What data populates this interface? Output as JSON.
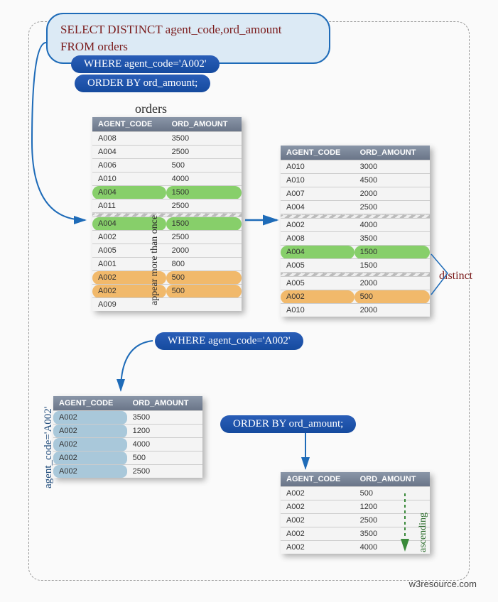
{
  "sql": {
    "line1": "SELECT  DISTINCT agent_code,ord_amount",
    "line2": "FROM orders",
    "where": "WHERE agent_code='A002'",
    "orderby": "ORDER BY ord_amount;"
  },
  "labels": {
    "orders": "orders",
    "appear": "appear more than once",
    "distinct": "distinct",
    "agentcode": "agent_code='A002'",
    "ascending": "ascending",
    "where2": "WHERE agent_code='A002'",
    "orderby2": "ORDER BY ord_amount;"
  },
  "headers": {
    "col1": "AGENT_CODE",
    "col2": "ORD_AMOUNT"
  },
  "tables": {
    "orders1": [
      [
        "A008",
        "3500"
      ],
      [
        "A004",
        "2500"
      ],
      [
        "A006",
        "500"
      ],
      [
        "A010",
        "4000"
      ],
      [
        "A004",
        "1500",
        "green"
      ],
      [
        "A011",
        "2500"
      ],
      [
        "tear"
      ],
      [
        "A004",
        "1500",
        "green"
      ],
      [
        "A002",
        "2500"
      ],
      [
        "A005",
        "2000"
      ],
      [
        "A001",
        "800"
      ],
      [
        "A002",
        "500",
        "orange"
      ],
      [
        "A002",
        "500",
        "orange"
      ],
      [
        "A009",
        ""
      ]
    ],
    "orders2": [
      [
        "A010",
        "3000"
      ],
      [
        "A010",
        "4500"
      ],
      [
        "A007",
        "2000"
      ],
      [
        "A004",
        "2500"
      ],
      [
        "tear"
      ],
      [
        "A002",
        "4000"
      ],
      [
        "A008",
        "3500"
      ],
      [
        "A004",
        "1500",
        "green"
      ],
      [
        "A005",
        "1500"
      ],
      [
        "tear"
      ],
      [
        "A005",
        "2000"
      ],
      [
        "A002",
        "500",
        "orange"
      ],
      [
        "A010",
        "2000"
      ]
    ],
    "filtered": [
      [
        "A002",
        "3500"
      ],
      [
        "A002",
        "1200"
      ],
      [
        "A002",
        "4000"
      ],
      [
        "A002",
        "500"
      ],
      [
        "A002",
        "2500"
      ]
    ],
    "sorted": [
      [
        "A002",
        "500"
      ],
      [
        "A002",
        "1200"
      ],
      [
        "A002",
        "2500"
      ],
      [
        "A002",
        "3500"
      ],
      [
        "A002",
        "4000"
      ]
    ]
  },
  "footer": "w3resource.com"
}
